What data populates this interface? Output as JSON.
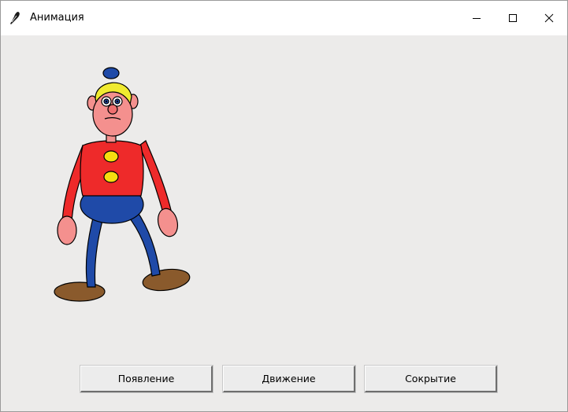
{
  "window": {
    "title": "Анимация",
    "icon": "feather-icon",
    "controls": [
      "minimize-icon",
      "maximize-icon",
      "close-icon"
    ]
  },
  "buttons": {
    "appear_label": "Появление",
    "move_label": "Движение",
    "hide_label": "Сокрытие"
  },
  "figure": {
    "description_colors": {
      "shirt": "#ee2a2a",
      "pants": "#1f4aa8",
      "skin": "#f4908e",
      "hair": "#f0ea30",
      "hat": "#1f4aa8",
      "buttons": "#f5de10",
      "shoes": "#8a5a2c"
    }
  }
}
